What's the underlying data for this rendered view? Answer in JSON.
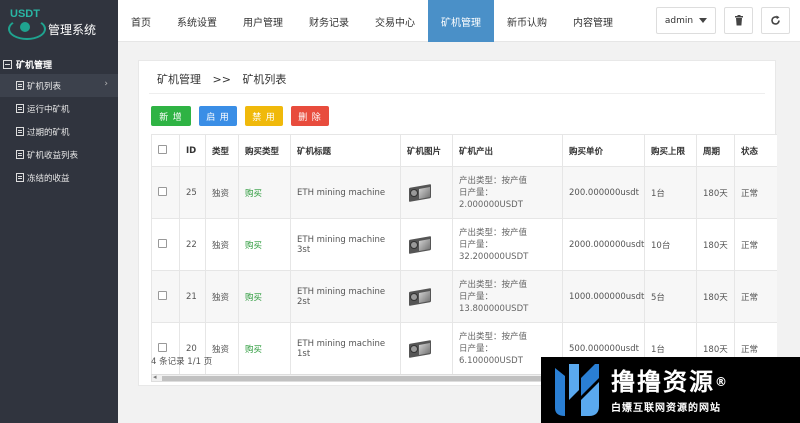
{
  "app": {
    "logo_text": "USDT",
    "title": "管理系统"
  },
  "sidebar": {
    "group_label": "矿机管理",
    "items": [
      {
        "label": "矿机列表",
        "active": true
      },
      {
        "label": "运行中矿机"
      },
      {
        "label": "过期的矿机"
      },
      {
        "label": "矿机收益列表"
      },
      {
        "label": "冻结的收益"
      }
    ]
  },
  "topnav": {
    "tabs": [
      {
        "label": "首页"
      },
      {
        "label": "系统设置"
      },
      {
        "label": "用户管理"
      },
      {
        "label": "财务记录"
      },
      {
        "label": "交易中心"
      },
      {
        "label": "矿机管理",
        "active": true
      },
      {
        "label": "新币认购"
      },
      {
        "label": "内容管理"
      }
    ],
    "user": "admin",
    "icons": [
      "trash-icon",
      "refresh-icon"
    ]
  },
  "breadcrumb": {
    "parent": "矿机管理",
    "separator": ">>",
    "current": "矿机列表"
  },
  "toolbar": {
    "add": "新 增",
    "enable": "启 用",
    "disable": "禁 用",
    "delete": "删 除"
  },
  "table": {
    "headers": [
      "",
      "ID",
      "类型",
      "购买类型",
      "矿机标题",
      "矿机图片",
      "矿机产出",
      "购买单价",
      "购买上限",
      "周期",
      "状态"
    ],
    "rows": [
      {
        "id": "25",
        "type": "独资",
        "buy_type": "购买",
        "title": "ETH mining machine",
        "output_type": "产出类型：按产值",
        "daily": "日产量：2.000000USDT",
        "price": "200.000000usdt",
        "limit": "1台",
        "cycle": "180天",
        "status": "正常"
      },
      {
        "id": "22",
        "type": "独资",
        "buy_type": "购买",
        "title": "ETH mining machine 3st",
        "output_type": "产出类型：按产值",
        "daily": "日产量：32.200000USDT",
        "price": "2000.000000usdt",
        "limit": "10台",
        "cycle": "180天",
        "status": "正常"
      },
      {
        "id": "21",
        "type": "独资",
        "buy_type": "购买",
        "title": "ETH mining machine 2st",
        "output_type": "产出类型：按产值",
        "daily": "日产量：13.800000USDT",
        "price": "1000.000000usdt",
        "limit": "5台",
        "cycle": "180天",
        "status": "正常"
      },
      {
        "id": "20",
        "type": "独资",
        "buy_type": "购买",
        "title": "ETH mining machine 1st",
        "output_type": "产出类型：按产值",
        "daily": "日产量：6.100000USDT",
        "price": "500.000000usdt",
        "limit": "1台",
        "cycle": "180天",
        "status": "正常"
      }
    ]
  },
  "pagination": {
    "summary": "4 条记录 1/1 页"
  },
  "watermark": {
    "big": "撸撸资源",
    "registered": "®",
    "small": "白嫖互联网资源的网站"
  },
  "colors": {
    "sidebar_bg": "#30343e",
    "nav_active": "#4a90c8",
    "btn_add": "#2fb344",
    "btn_enable": "#3a8ee6",
    "btn_disable": "#f0b90b",
    "btn_delete": "#e84c3d"
  }
}
